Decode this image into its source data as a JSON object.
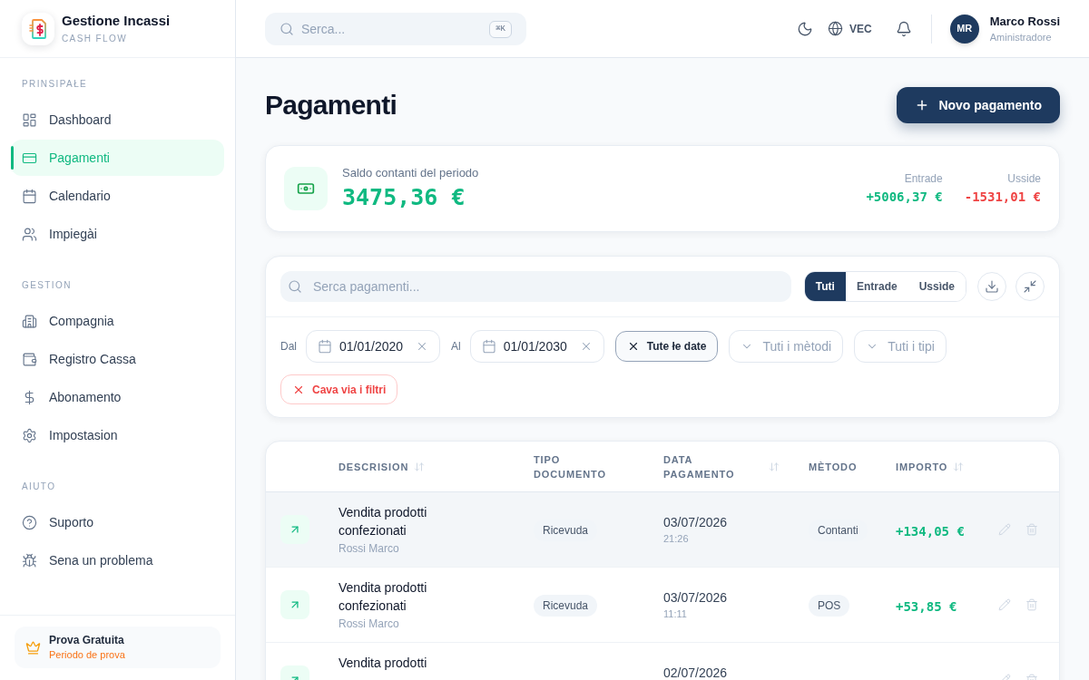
{
  "sidebar": {
    "brand": {
      "title": "Gestione Incassi",
      "subtitle": "CASH FLOW"
    },
    "sections": [
      {
        "label": "PRINSIPAŁE",
        "items": [
          {
            "label": "Dashboard",
            "selected": false
          },
          {
            "label": "Pagamenti",
            "selected": true
          },
          {
            "label": "Calendario",
            "selected": false
          },
          {
            "label": "Impiegài",
            "selected": false
          }
        ]
      },
      {
        "label": "GESTION",
        "items": [
          {
            "label": "Compagnia",
            "selected": false
          },
          {
            "label": "Registro Cassa",
            "selected": false
          },
          {
            "label": "Abonamento",
            "selected": false
          },
          {
            "label": "Impostasion",
            "selected": false
          }
        ]
      },
      {
        "label": "AIUTO",
        "items": [
          {
            "label": "Suporto",
            "selected": false
          },
          {
            "label": "Sena un problema",
            "selected": false
          }
        ]
      }
    ],
    "trial": {
      "title": "Prova Gratuita",
      "subtitle": "Periodo de prova"
    }
  },
  "topbar": {
    "search": {
      "placeholder": "Serca...",
      "shortcut": "⌘K"
    },
    "language": "VEC",
    "user": {
      "initials": "MR",
      "name": "Marco Rossi",
      "role": "Aministradore"
    }
  },
  "page": {
    "title": "Pagamenti",
    "action": "Novo pagamento"
  },
  "balance": {
    "label": "Saldo contanti del periodo",
    "value": "3475,36 €",
    "totals": [
      {
        "kind": "in",
        "label": "Entrade",
        "value": "+5006,37 €"
      },
      {
        "kind": "out",
        "label": "Usside",
        "value": "-1531,01 €"
      }
    ]
  },
  "filters": {
    "search": {
      "placeholder": "Serca pagamenti..."
    },
    "type_tabs": [
      {
        "label": "Tuti",
        "selected": true
      },
      {
        "label": "Entrade",
        "selected": false
      },
      {
        "label": "Ussìde",
        "selected": false
      }
    ],
    "date_from": {
      "label": "Dal",
      "value": "01/01/2020"
    },
    "date_to": {
      "label": "Al",
      "value": "01/01/2030"
    },
    "date_preset": "Tute łe date",
    "method": {
      "placeholder": "Tuti i mètodi"
    },
    "doc_type": {
      "placeholder": "Tuti i tipi"
    },
    "clear": "Cava via i filtri"
  },
  "table": {
    "columns": [
      {
        "label": "DESCRISION",
        "sortable": true
      },
      {
        "label": "TIPO DOCUMENTO",
        "sortable": false
      },
      {
        "label": "DATA PAGAMENTO",
        "sortable": true
      },
      {
        "label": "MÈTODO",
        "sortable": false
      },
      {
        "label": "IMPORTO",
        "sortable": true
      }
    ],
    "rows": [
      {
        "kind": "in",
        "selected": true,
        "description": "Vendita prodotti confezionati",
        "person": "Rossi Marco",
        "doc_type": "Ricevuda",
        "date": "03/07/2026",
        "time": "21:26",
        "method": "Contanti",
        "amount": "+134,05 €"
      },
      {
        "kind": "in",
        "selected": false,
        "description": "Vendita prodotti confezionati",
        "person": "Rossi Marco",
        "doc_type": "Ricevuda",
        "date": "03/07/2026",
        "time": "11:11",
        "method": "POS",
        "amount": "+53,85 €"
      },
      {
        "kind": "in",
        "selected": false,
        "description": "Vendita prodotti",
        "date": "02/07/2026"
      }
    ]
  }
}
